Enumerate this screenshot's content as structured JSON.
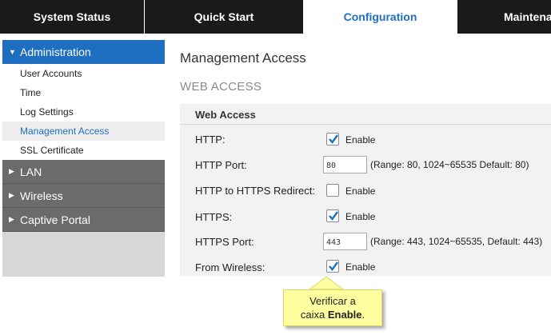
{
  "topnav": {
    "tabs": [
      {
        "label": "System Status"
      },
      {
        "label": "Quick Start"
      },
      {
        "label": "Configuration"
      },
      {
        "label": "Maintenance"
      }
    ]
  },
  "sidebar": {
    "administration": {
      "label": "Administration",
      "items": [
        {
          "label": "User Accounts"
        },
        {
          "label": "Time"
        },
        {
          "label": "Log Settings"
        },
        {
          "label": "Management Access"
        },
        {
          "label": "SSL Certificate"
        }
      ]
    },
    "groups": [
      {
        "label": "LAN"
      },
      {
        "label": "Wireless"
      },
      {
        "label": "Captive Portal"
      }
    ]
  },
  "main": {
    "title": "Management Access",
    "section_title": "WEB ACCESS",
    "panel_title": "Web Access",
    "rows": {
      "http": {
        "label": "HTTP:",
        "enable_label": "Enable",
        "checked": true
      },
      "http_port": {
        "label": "HTTP Port:",
        "value": "80",
        "hint": "(Range: 80, 1024~65535 Default: 80)"
      },
      "redirect": {
        "label": "HTTP to HTTPS Redirect:",
        "enable_label": "Enable",
        "checked": false
      },
      "https": {
        "label": "HTTPS:",
        "enable_label": "Enable",
        "checked": true
      },
      "https_port": {
        "label": "HTTPS Port:",
        "value": "443",
        "hint": "(Range: 443, 1024~65535, Default: 443)"
      },
      "from_wireless": {
        "label": "From Wireless:",
        "enable_label": "Enable",
        "checked": true
      }
    }
  },
  "callout": {
    "line1": "Verificar a",
    "line2_prefix": "caixa ",
    "line2_bold": "Enable",
    "line2_suffix": "."
  },
  "colors": {
    "accent": "#1e6fc2",
    "nav_bg": "#1a1a1a",
    "sidebar_collapsed": "#6b6b6b",
    "callout_bg": "#ffffa0"
  }
}
